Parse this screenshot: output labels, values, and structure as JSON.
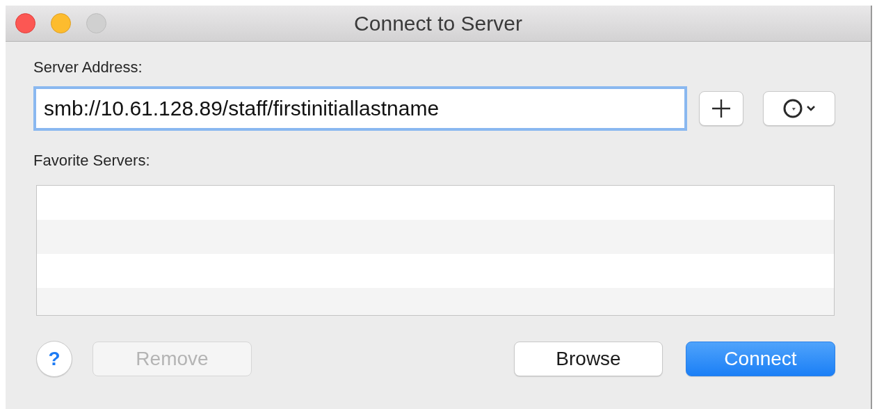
{
  "window": {
    "title": "Connect to Server",
    "controls": [
      {
        "kind": "close",
        "disabled": false
      },
      {
        "kind": "minimize",
        "disabled": false
      },
      {
        "kind": "zoom",
        "disabled": true
      }
    ]
  },
  "server_address": {
    "label": "Server Address:",
    "value": "smb://10.61.128.89/staff/firstinitiallastname",
    "focused": true
  },
  "favorite_servers": {
    "label": "Favorite Servers:"
  },
  "buttons": [
    {
      "kind": "help",
      "label": "?",
      "disabled": false,
      "default": false
    },
    {
      "kind": "plain",
      "label": "Remove",
      "disabled": true,
      "default": false
    },
    {
      "kind": "plain",
      "label": "Browse",
      "disabled": false,
      "default": false
    },
    {
      "kind": "plain",
      "label": "Connect",
      "disabled": false,
      "default": true
    }
  ]
}
